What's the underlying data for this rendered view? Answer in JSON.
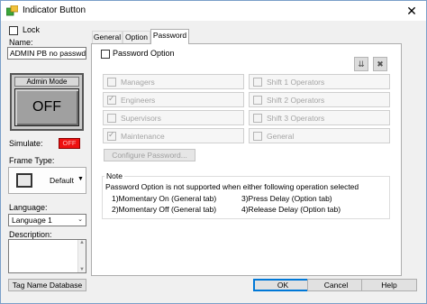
{
  "window": {
    "title": "Indicator Button",
    "close": "✕"
  },
  "left": {
    "lock_label": "Lock",
    "name_label": "Name:",
    "name_value": "ADMIN PB no passwd",
    "preview": {
      "caption": "Admin Mode",
      "state": "OFF"
    },
    "simulate_label": "Simulate:",
    "simulate_value": "OFF",
    "frame_type_label": "Frame Type:",
    "frame_type_value": "Default",
    "language_label": "Language:",
    "language_value": "Language 1",
    "description_label": "Description:",
    "tag_db_button": "Tag Name Database"
  },
  "tabs": [
    {
      "label": "General"
    },
    {
      "label": "Option"
    },
    {
      "label": "Password",
      "active": true
    }
  ],
  "password": {
    "option_label": "Password Option",
    "groups_left": [
      {
        "label": "Managers",
        "checked": false
      },
      {
        "label": "Engineers",
        "checked": true
      },
      {
        "label": "Supervisors",
        "checked": false
      },
      {
        "label": "Maintenance",
        "checked": true
      }
    ],
    "groups_right": [
      {
        "label": "Shift 1 Operators",
        "checked": false
      },
      {
        "label": "Shift 2 Operators",
        "checked": false
      },
      {
        "label": "Shift 3 Operators",
        "checked": false
      },
      {
        "label": "General",
        "checked": false
      }
    ],
    "configure_button": "Configure Password..."
  },
  "note": {
    "title": "Note",
    "text": "Password Option is not supported when either following operation selected",
    "items": [
      "1)Momentary On (General tab)",
      "2)Momentary Off (General tab)",
      "3)Press Delay (Option tab)",
      "4)Release Delay (Option tab)"
    ]
  },
  "footer": {
    "ok": "OK",
    "cancel": "Cancel",
    "help": "Help"
  },
  "colors": {
    "simulate_bg": "#ee1111",
    "button_face": "#a0a0a0",
    "default_button_border": "#0078d7"
  }
}
